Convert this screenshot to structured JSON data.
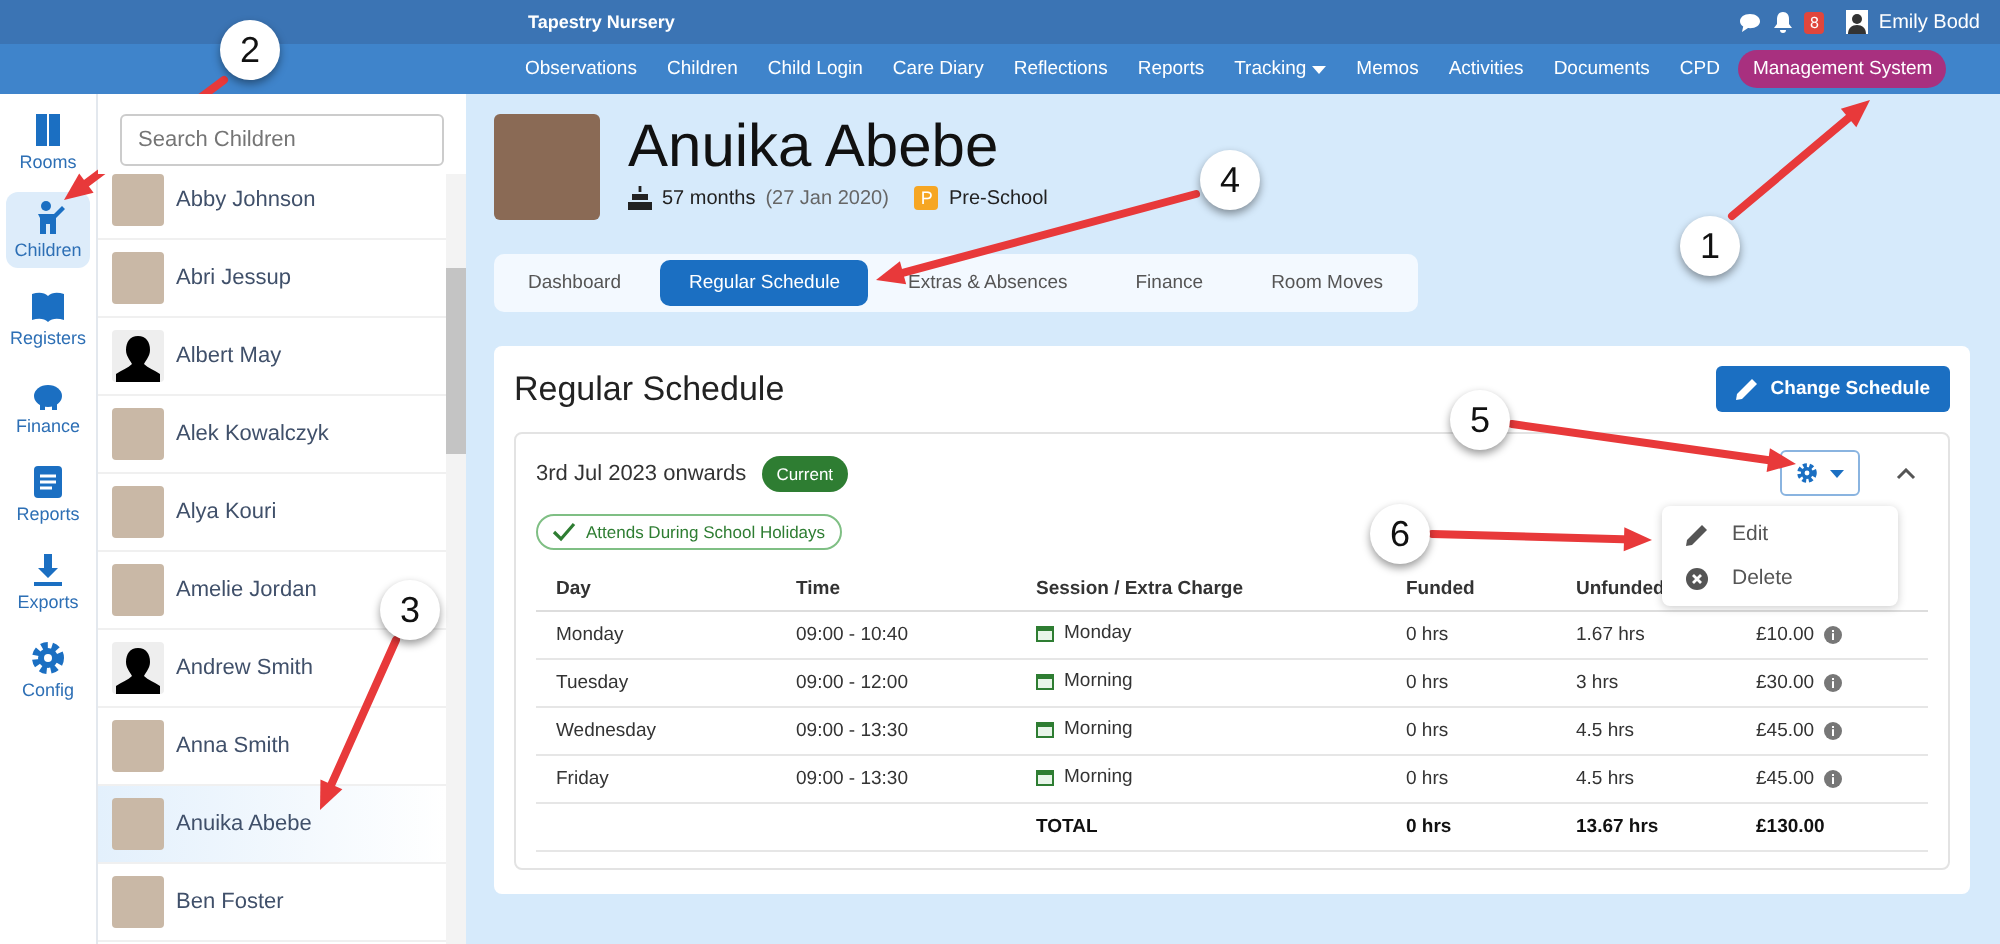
{
  "top_bar": {
    "title": "Tapestry Nursery",
    "notifications": "8",
    "user": "Emily Bodd"
  },
  "nav": [
    {
      "label": "Observations",
      "kind": "link"
    },
    {
      "label": "Children",
      "kind": "link"
    },
    {
      "label": "Child Login",
      "kind": "link"
    },
    {
      "label": "Care Diary",
      "kind": "link"
    },
    {
      "label": "Reflections",
      "kind": "link"
    },
    {
      "label": "Reports",
      "kind": "link"
    },
    {
      "label": "Tracking",
      "kind": "dropdown"
    },
    {
      "label": "Memos",
      "kind": "link"
    },
    {
      "label": "Activities",
      "kind": "link"
    },
    {
      "label": "Documents",
      "kind": "link"
    },
    {
      "label": "CPD",
      "kind": "link"
    },
    {
      "label": "Management System",
      "kind": "pill"
    }
  ],
  "rail": [
    {
      "label": "Rooms",
      "selected": false
    },
    {
      "label": "Children",
      "selected": true
    },
    {
      "label": "Registers",
      "selected": false
    },
    {
      "label": "Finance",
      "selected": false
    },
    {
      "label": "Reports",
      "selected": false
    },
    {
      "label": "Exports",
      "selected": false
    },
    {
      "label": "Config",
      "selected": false
    }
  ],
  "children_list": {
    "placeholder": "Search Children",
    "items": [
      {
        "name": "Abby Johnson",
        "kind": "photo",
        "selected": false
      },
      {
        "name": "Abri Jessup",
        "kind": "photo",
        "selected": false
      },
      {
        "name": "Albert May",
        "kind": "silhouette",
        "selected": false
      },
      {
        "name": "Alek Kowalczyk",
        "kind": "photo",
        "selected": false
      },
      {
        "name": "Alya Kouri",
        "kind": "photo",
        "selected": false
      },
      {
        "name": "Amelie Jordan",
        "kind": "photo",
        "selected": false
      },
      {
        "name": "Andrew Smith",
        "kind": "silhouette",
        "selected": false
      },
      {
        "name": "Anna Smith",
        "kind": "photo",
        "selected": false
      },
      {
        "name": "Anuika Abebe",
        "kind": "photo",
        "selected": true
      },
      {
        "name": "Ben Foster",
        "kind": "photo",
        "selected": false
      }
    ]
  },
  "child": {
    "name": "Anuika Abebe",
    "age": "57 months",
    "dob": "(27 Jan 2020)",
    "room_badge": "P",
    "room": "Pre-School"
  },
  "tabs": [
    {
      "label": "Dashboard",
      "selected": false
    },
    {
      "label": "Regular Schedule",
      "selected": true
    },
    {
      "label": "Extras & Absences",
      "selected": false
    },
    {
      "label": "Finance",
      "selected": false
    },
    {
      "label": "Room Moves",
      "selected": false
    }
  ],
  "schedule": {
    "title": "Regular Schedule",
    "change_button": "Change Schedule",
    "period": "3rd Jul 2023 onwards",
    "status": "Current",
    "holiday_tag": "Attends During School Holidays",
    "menu": [
      {
        "label": "Edit",
        "kind": "edit"
      },
      {
        "label": "Delete",
        "kind": "delete"
      }
    ],
    "columns": [
      "Day",
      "Time",
      "Session / Extra Charge",
      "Funded",
      "Unfunded"
    ],
    "rows": [
      {
        "day": "Monday",
        "time": "09:00 - 10:40",
        "session": "Monday",
        "funded": "0 hrs",
        "unfunded": "1.67 hrs",
        "cost": "£10.00"
      },
      {
        "day": "Tuesday",
        "time": "09:00 - 12:00",
        "session": "Morning",
        "funded": "0 hrs",
        "unfunded": "3 hrs",
        "cost": "£30.00"
      },
      {
        "day": "Wednesday",
        "time": "09:00 - 13:30",
        "session": "Morning",
        "funded": "0 hrs",
        "unfunded": "4.5 hrs",
        "cost": "£45.00"
      },
      {
        "day": "Friday",
        "time": "09:00 - 13:30",
        "session": "Morning",
        "funded": "0 hrs",
        "unfunded": "4.5 hrs",
        "cost": "£45.00"
      }
    ],
    "total": {
      "label": "TOTAL",
      "funded": "0 hrs",
      "unfunded": "13.67 hrs",
      "cost": "£130.00"
    }
  },
  "callouts": [
    "1",
    "2",
    "3",
    "4",
    "5",
    "6"
  ]
}
